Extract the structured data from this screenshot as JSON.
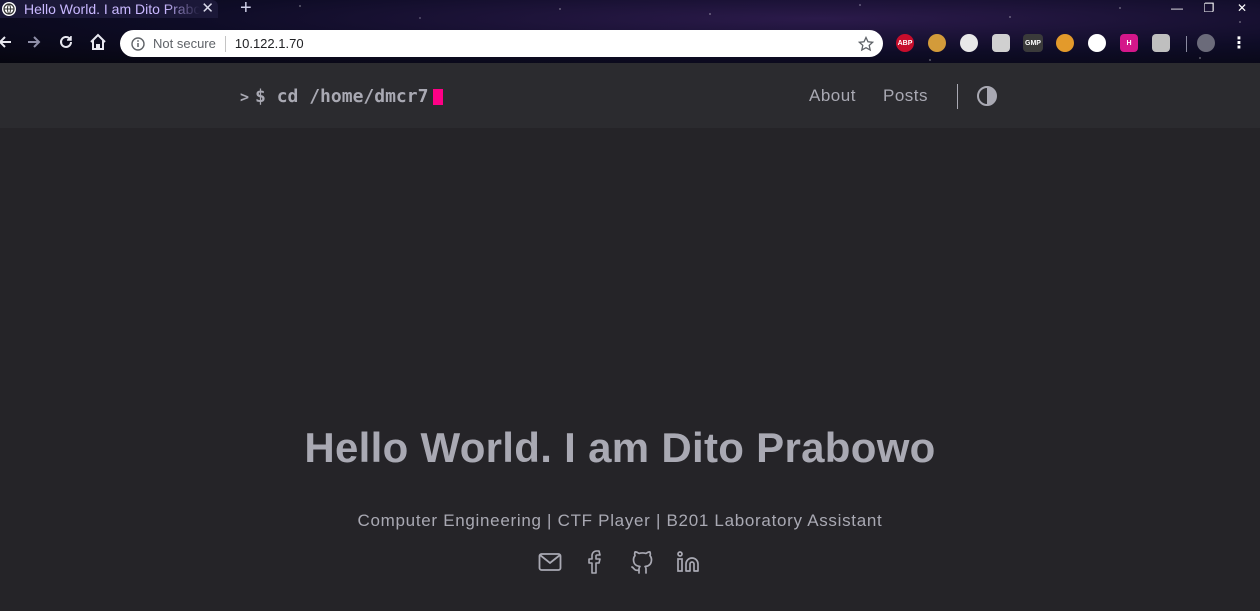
{
  "browser": {
    "tab": {
      "title": "Hello World. I am Dito Prabowo",
      "close_glyph": "✕",
      "favicon": "globe-icon"
    },
    "new_tab_glyph": "+",
    "window_controls": {
      "minimize": "—",
      "restore": "❐",
      "close": "✕"
    },
    "address_bar": {
      "security_label": "Not secure",
      "url": "10.122.1.70"
    },
    "extensions": [
      {
        "name": "adblock-plus",
        "label": "ABP",
        "color": "#c70d2c"
      },
      {
        "name": "cookie",
        "label": "",
        "color": "#d39b3a"
      },
      {
        "name": "extension-3",
        "label": "",
        "color": "#e8e8e8"
      },
      {
        "name": "extension-4",
        "label": "",
        "color": "#d0d0d0"
      },
      {
        "name": "gmp",
        "label": "GMP",
        "color": "#3a3a3a"
      },
      {
        "name": "extension-6",
        "label": "",
        "color": "#e39a2b"
      },
      {
        "name": "extension-7",
        "label": "",
        "color": "#ffffff"
      },
      {
        "name": "extension-8",
        "label": "H",
        "color": "#d4178a"
      },
      {
        "name": "extension-9",
        "label": "",
        "color": "#bfbfbf"
      }
    ]
  },
  "site": {
    "logo": {
      "prompt": ">",
      "text": "$ cd /home/dmcr7"
    },
    "nav": [
      {
        "label": "About"
      },
      {
        "label": "Posts"
      }
    ],
    "accent_color": "#fe0086",
    "text_color": "#a9a9b3",
    "hero": {
      "title": "Hello World. I am Dito Prabowo",
      "subtitle": "Computer Engineering | CTF Player | B201 Laboratory Assistant"
    },
    "socials": [
      {
        "icon": "mail-icon"
      },
      {
        "icon": "facebook-icon"
      },
      {
        "icon": "github-icon"
      },
      {
        "icon": "linkedin-icon"
      }
    ]
  }
}
